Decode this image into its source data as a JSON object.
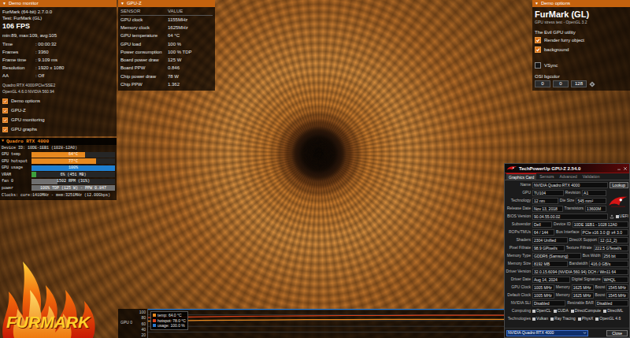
{
  "demo_monitor": {
    "toggle": "▼",
    "title": "Demo monitor",
    "app": "FurMark (64-bit) 2.7.0.0",
    "test": "Test: FurMark (GL)",
    "fps": "106 FPS",
    "fps_stats": "min:89, max:109, avg:105",
    "stats": [
      {
        "label": "Time",
        "value": ": 00:00:32"
      },
      {
        "label": "Frames",
        "value": ": 3360"
      },
      {
        "label": "Frame time",
        "value": ": 9.109 ms"
      },
      {
        "label": "Resolution",
        "value": ": 1920 x 1080"
      },
      {
        "label": "AA",
        "value": ": Off"
      }
    ],
    "renderer": "Quadro RTX 4000/PCIe/SSE2",
    "opengl": "OpenGL 4.6.0 NVIDIA 560.94",
    "options": [
      {
        "label": "Demo options",
        "checked": true
      },
      {
        "label": "GPU-Z",
        "checked": true
      },
      {
        "label": "GPU monitoring",
        "checked": true
      },
      {
        "label": "GPU graphs",
        "checked": true
      }
    ]
  },
  "gpu_monitor": {
    "toggle": "▼",
    "title": "Quadro RTX 4000",
    "device": "Device ID: 10DE-1EB1 (1028-12A0)",
    "meters": [
      {
        "label": "GPU temp",
        "reading": "64°C",
        "level": 0.64,
        "color": "#e8891f"
      },
      {
        "label": "GPU hotspot",
        "reading": "77°C",
        "level": 0.77,
        "color": "#e8891f"
      },
      {
        "label": "GPU usage",
        "reading": "100%",
        "level": 1,
        "color": "#1f7fd0"
      },
      {
        "label": "VRAM",
        "reading": "6% (451 MB)",
        "level": 0.06,
        "color": "#3da03d"
      },
      {
        "label": "fan 0",
        "reading": "1502 RPM (31%)",
        "level": 0.31,
        "color": "#6f6f6f"
      },
      {
        "label": "power",
        "reading": "100% TDP (125 W) - PPW 0.847",
        "level": 1,
        "color": "#6f6f6f"
      }
    ],
    "clocks": "Clocks: core:1410MHz - mem:3251MHz (12.00Gbps)"
  },
  "gpuz_sensors": {
    "toggle": "▼",
    "title": "GPU-Z",
    "columns": [
      "SENSOR",
      "VALUE"
    ],
    "rows": [
      [
        "GPU clock",
        "1155MHz"
      ],
      [
        "Memory clock",
        "1625MHz"
      ],
      [
        "GPU temperature",
        "64 °C"
      ],
      [
        "GPU load",
        "100 %"
      ],
      [
        "Power consumption",
        "100 % TDP"
      ],
      [
        "Board power draw",
        "125 W"
      ],
      [
        "Board PPW",
        "0.846"
      ],
      [
        "Chip power draw",
        "78 W"
      ],
      [
        "Chip PPW",
        "1.362"
      ]
    ]
  },
  "demo_options": {
    "toggle": "▼",
    "title": "Demo options",
    "app": "FurMark (GL)",
    "subtitle": "GPU stress test - OpenGL 3.2",
    "tagline": "The Evil GPU utility",
    "options": [
      {
        "label": "Render furry object",
        "checked": true
      },
      {
        "label": "background",
        "checked": true
      },
      {
        "label": "VSync",
        "checked": false
      }
    ],
    "bgcolor_label": "OSI bgcolor",
    "bgcolor": [
      "0",
      "0",
      "128"
    ]
  },
  "graph": {
    "title": "GPU 0",
    "ticks": [
      "100",
      "80",
      "60",
      "40",
      "20"
    ],
    "legend": [
      {
        "label": "temp: 64.0 °C",
        "color": "#e8891f",
        "values": [
          58,
          60,
          61,
          62,
          63,
          63,
          64,
          64,
          64,
          64
        ]
      },
      {
        "label": "hotspot: 78.0 °C",
        "color": "#d9401a",
        "values": [
          70,
          72,
          74,
          75,
          76,
          77,
          77,
          78,
          78,
          78
        ]
      },
      {
        "label": "usage: 100.0 %",
        "color": "#2a7ad0",
        "values": [
          100,
          100,
          100,
          100,
          100,
          100,
          100,
          100,
          100,
          100
        ]
      }
    ]
  },
  "logo": {
    "text": "FURMARK"
  },
  "gpuz": {
    "title": "TechPowerUp GPU-Z 2.54.0",
    "tabs": [
      {
        "label": "Graphics Card",
        "selected": true
      },
      {
        "label": "Sensors",
        "selected": false
      },
      {
        "label": "Advanced",
        "selected": false
      },
      {
        "label": "Validation",
        "selected": false
      }
    ],
    "rows": [
      {
        "kind": "fields",
        "cells": [
          {
            "label": "Name",
            "value": "NVIDIA Quadro RTX 4000"
          }
        ],
        "button": "Lookup"
      },
      {
        "kind": "fields",
        "cells": [
          {
            "label": "GPU",
            "value": "TU104"
          },
          {
            "label": "Revision",
            "value": "A1"
          }
        ]
      },
      {
        "kind": "fields",
        "cells": [
          {
            "label": "Technology",
            "value": "12 nm"
          },
          {
            "label": "Die Size",
            "value": "545 mm²"
          }
        ]
      },
      {
        "kind": "fields",
        "cells": [
          {
            "label": "Release Date",
            "value": "Nov 13, 2018"
          },
          {
            "label": "Transistors",
            "value": "13600M"
          }
        ]
      },
      {
        "kind": "fields",
        "cells": [
          {
            "label": "BIOS Version",
            "value": "90.04.55.00.02"
          }
        ],
        "check": {
          "label": "UEFI",
          "checked": true
        }
      },
      {
        "kind": "fields",
        "cells": [
          {
            "label": "Subvendor",
            "value": "Dell"
          },
          {
            "label": "Device ID",
            "value": "10DE 1EB1 - 1028 12A0"
          }
        ]
      },
      {
        "kind": "fields",
        "cells": [
          {
            "label": "ROPs/TMUs",
            "value": "64 / 144"
          },
          {
            "label": "Bus Interface",
            "value": "PCIe x16 3.0 @ x4 3.0"
          }
        ]
      },
      {
        "kind": "fields",
        "cells": [
          {
            "label": "Shaders",
            "value": "2304 Unified"
          },
          {
            "label": "DirectX Support",
            "value": "12 (12_2)"
          }
        ]
      },
      {
        "kind": "fields",
        "cells": [
          {
            "label": "Pixel Fillrate",
            "value": "98.9 GPixel/s"
          },
          {
            "label": "Texture Fillrate",
            "value": "222.5 GTexel/s"
          }
        ]
      },
      {
        "kind": "fields",
        "cells": [
          {
            "label": "Memory Type",
            "value": "GDDR6 (Samsung)"
          },
          {
            "label": "Bus Width",
            "value": "256 bit"
          }
        ]
      },
      {
        "kind": "fields",
        "cells": [
          {
            "label": "Memory Size",
            "value": "8192 MB"
          },
          {
            "label": "Bandwidth",
            "value": "416.0 GB/s"
          }
        ]
      },
      {
        "kind": "fields",
        "cells": [
          {
            "label": "Driver Version",
            "value": "32.0.15.6094 (NVIDIA 560.94) DCH / Win11 64"
          }
        ]
      },
      {
        "kind": "fields",
        "cells": [
          {
            "label": "Driver Date",
            "value": "Aug 14, 2024"
          },
          {
            "label": "Digital Signature",
            "value": "WHQL"
          }
        ]
      },
      {
        "kind": "fields",
        "cells": [
          {
            "label": "GPU Clock",
            "value": "1005 MHz"
          },
          {
            "label": "Memory",
            "value": "1625 MHz"
          },
          {
            "label": "Boost",
            "value": "1545 MHz"
          }
        ]
      },
      {
        "kind": "fields",
        "cells": [
          {
            "label": "Default Clock",
            "value": "1005 MHz"
          },
          {
            "label": "Memory",
            "value": "1625 MHz"
          },
          {
            "label": "Boost",
            "value": "1545 MHz"
          }
        ]
      },
      {
        "kind": "fields",
        "cells": [
          {
            "label": "NVIDIA SLI",
            "value": "Disabled"
          },
          {
            "label": "Resizable BAR",
            "value": "Disabled"
          }
        ]
      },
      {
        "kind": "checks",
        "label": "Computing",
        "items": [
          {
            "label": "OpenCL",
            "checked": true
          },
          {
            "label": "CUDA",
            "checked": true
          },
          {
            "label": "DirectCompute",
            "checked": true
          },
          {
            "label": "DirectML",
            "checked": true
          }
        ]
      },
      {
        "kind": "checks",
        "label": "Technologies",
        "items": [
          {
            "label": "Vulkan",
            "checked": true
          },
          {
            "label": "Ray Tracing",
            "checked": true
          },
          {
            "label": "PhysX",
            "checked": true
          },
          {
            "label": "OpenGL 4.6",
            "checked": true
          }
        ]
      }
    ],
    "device_select": "NVIDIA Quadro RTX 4000",
    "close": "Close"
  }
}
